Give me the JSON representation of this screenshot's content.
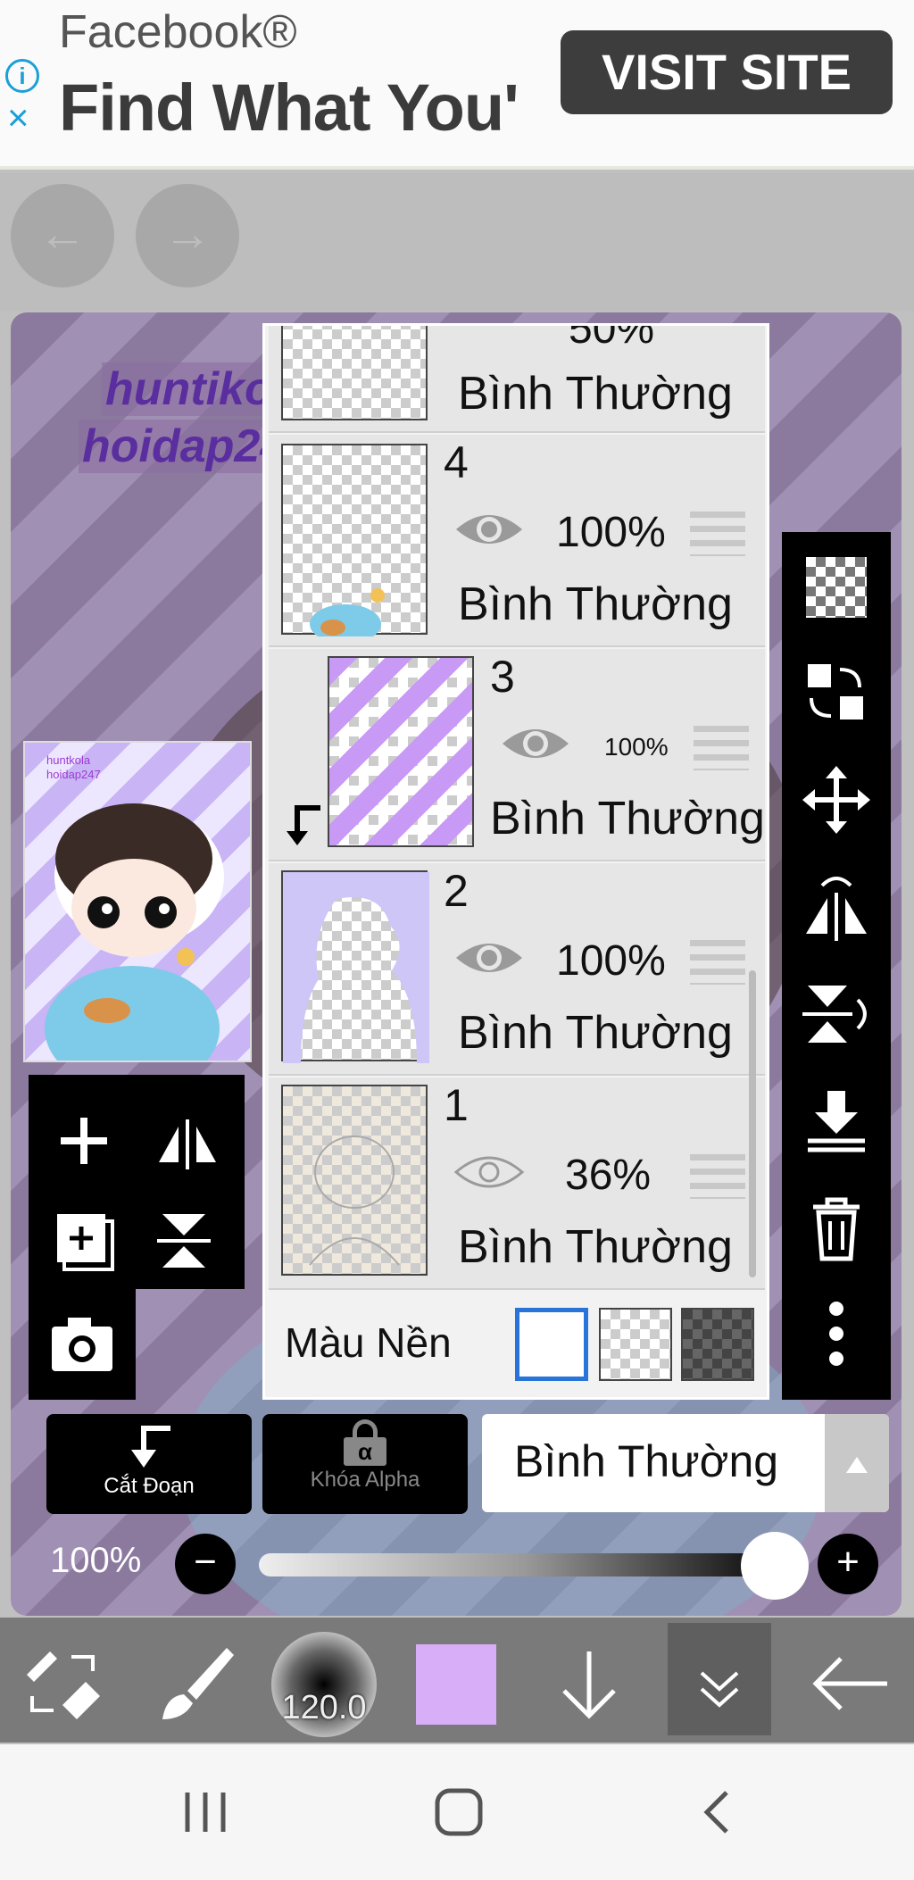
{
  "ad": {
    "brand": "Facebook®",
    "headline": "Find What You'",
    "button": "VISIT SITE",
    "info_icon": "i",
    "close_icon": "×"
  },
  "nav": {
    "back_icon": "←",
    "forward_icon": "→"
  },
  "canvas": {
    "watermark_line1": "huntiko",
    "watermark_line2": "hoidap24",
    "preview_watermark_line1": "huntkola",
    "preview_watermark_line2": "hoidap247"
  },
  "layers": {
    "partial_top": {
      "opacity": "50%",
      "mode": "Bình Thường"
    },
    "items": [
      {
        "number": "4",
        "opacity": "100%",
        "mode": "Bình Thường"
      },
      {
        "number": "3",
        "opacity": "100%",
        "mode": "Bình Thường"
      },
      {
        "number": "2",
        "opacity": "100%",
        "mode": "Bình Thường"
      },
      {
        "number": "1",
        "opacity": "36%",
        "mode": "Bình Thường"
      }
    ],
    "background_label": "Màu Nền"
  },
  "controls": {
    "clip_label": "Cắt Đoạn",
    "alpha_lock_label": "Khóa Alpha",
    "alpha_symbol": "α",
    "blend_mode": "Bình Thường",
    "layer_opacity": "100%",
    "minus": "−",
    "plus": "+"
  },
  "toolbar": {
    "brush_size": "120.0",
    "current_color": "#d8aef9"
  },
  "colors": {
    "ad_accent": "#1a9fd8",
    "panel_bg": "#e6e6e6",
    "toolbar_bg": "#7a7a7a"
  }
}
